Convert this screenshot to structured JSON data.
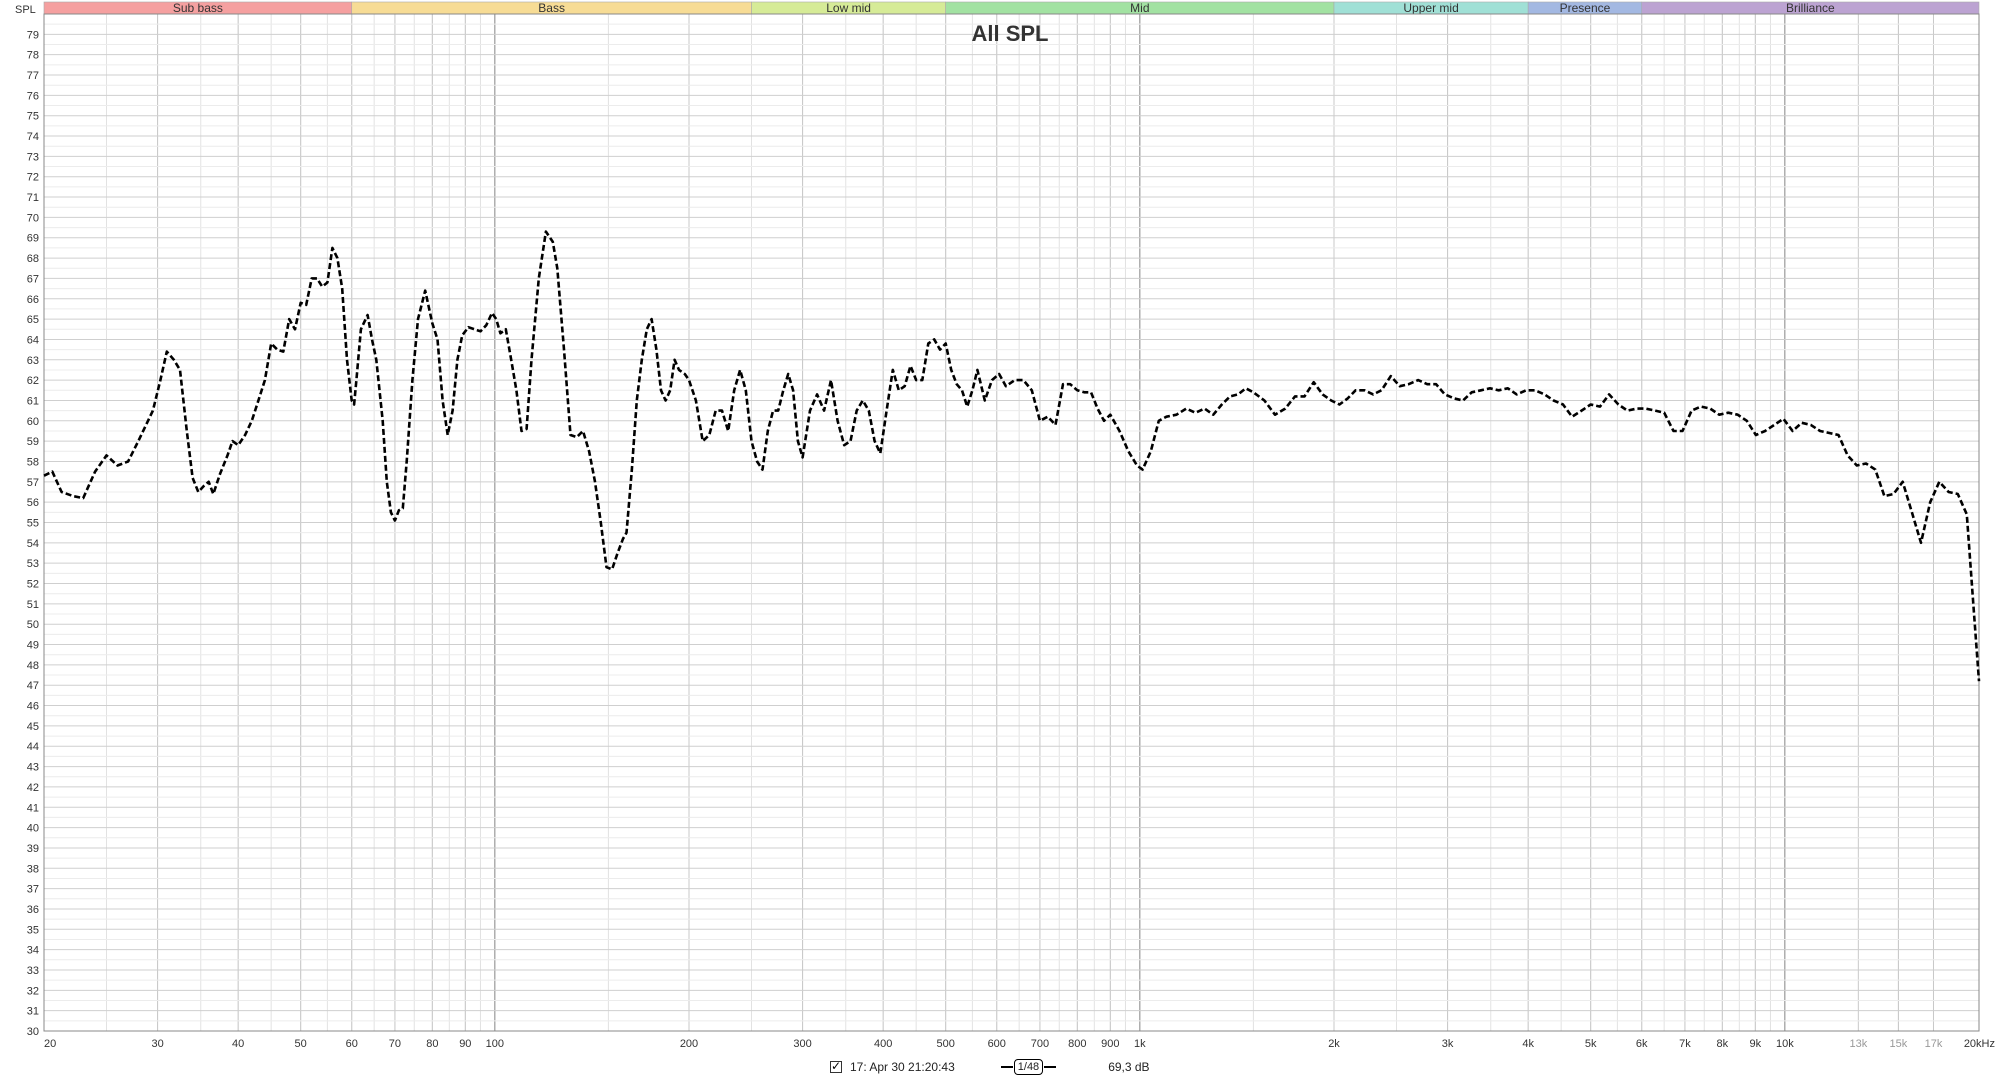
{
  "chart_data": {
    "type": "line",
    "title": "All SPL",
    "ylabel": "SPL",
    "xlabel": "",
    "xscale": "log",
    "xlim": [
      20,
      20000
    ],
    "ylim": [
      30,
      80
    ],
    "y_ticks": [
      30,
      31,
      32,
      33,
      34,
      35,
      36,
      37,
      38,
      39,
      40,
      41,
      42,
      43,
      44,
      45,
      46,
      47,
      48,
      49,
      50,
      51,
      52,
      53,
      54,
      55,
      56,
      57,
      58,
      59,
      60,
      61,
      62,
      63,
      64,
      65,
      66,
      67,
      68,
      69,
      70,
      71,
      72,
      73,
      74,
      75,
      76,
      77,
      78,
      79
    ],
    "x_ticks": [
      {
        "value": 20,
        "label": "20"
      },
      {
        "value": 30,
        "label": "30"
      },
      {
        "value": 40,
        "label": "40"
      },
      {
        "value": 50,
        "label": "50"
      },
      {
        "value": 60,
        "label": "60"
      },
      {
        "value": 70,
        "label": "70"
      },
      {
        "value": 80,
        "label": "80"
      },
      {
        "value": 90,
        "label": "90"
      },
      {
        "value": 100,
        "label": "100"
      },
      {
        "value": 200,
        "label": "200"
      },
      {
        "value": 300,
        "label": "300"
      },
      {
        "value": 400,
        "label": "400"
      },
      {
        "value": 500,
        "label": "500"
      },
      {
        "value": 600,
        "label": "600"
      },
      {
        "value": 700,
        "label": "700"
      },
      {
        "value": 800,
        "label": "800"
      },
      {
        "value": 900,
        "label": "900"
      },
      {
        "value": 1000,
        "label": "1k"
      },
      {
        "value": 2000,
        "label": "2k"
      },
      {
        "value": 3000,
        "label": "3k"
      },
      {
        "value": 4000,
        "label": "4k"
      },
      {
        "value": 5000,
        "label": "5k"
      },
      {
        "value": 6000,
        "label": "6k"
      },
      {
        "value": 7000,
        "label": "7k"
      },
      {
        "value": 8000,
        "label": "8k"
      },
      {
        "value": 9000,
        "label": "9k"
      },
      {
        "value": 10000,
        "label": "10k"
      },
      {
        "value": 13000,
        "label": "13k"
      },
      {
        "value": 15000,
        "label": "15k"
      },
      {
        "value": 17000,
        "label": "17k"
      },
      {
        "value": 20000,
        "label": "20kHz"
      }
    ],
    "grid": true,
    "bands": [
      {
        "name": "Sub bass",
        "from": 20,
        "to": 60,
        "color": "#f5a0a0"
      },
      {
        "name": "Bass",
        "from": 60,
        "to": 250,
        "color": "#f7dc95"
      },
      {
        "name": "Low mid",
        "from": 250,
        "to": 500,
        "color": "#d6eb97"
      },
      {
        "name": "Mid",
        "from": 500,
        "to": 2000,
        "color": "#a2e2a2"
      },
      {
        "name": "Upper mid",
        "from": 2000,
        "to": 4000,
        "color": "#a0e0d6"
      },
      {
        "name": "Presence",
        "from": 4000,
        "to": 6000,
        "color": "#a3b8e2"
      },
      {
        "name": "Brilliance",
        "from": 6000,
        "to": 20000,
        "color": "#bca3d2"
      }
    ],
    "series": [
      {
        "name": "17: Apr 30 21:20:43",
        "color": "#000000",
        "style": "dashed",
        "points": [
          [
            20,
            57.3
          ],
          [
            20.6,
            57.5
          ],
          [
            21.3,
            56.5
          ],
          [
            22.2,
            56.3
          ],
          [
            23,
            56.2
          ],
          [
            24,
            57.5
          ],
          [
            25,
            58.3
          ],
          [
            26,
            57.8
          ],
          [
            27,
            58
          ],
          [
            28,
            59
          ],
          [
            29.5,
            60.5
          ],
          [
            30.3,
            62
          ],
          [
            31,
            63.4
          ],
          [
            31.8,
            63
          ],
          [
            32.5,
            62.5
          ],
          [
            33.3,
            59.5
          ],
          [
            34,
            57.2
          ],
          [
            34.7,
            56.5
          ],
          [
            35.4,
            56.8
          ],
          [
            36,
            57
          ],
          [
            36.6,
            56.4
          ],
          [
            37.5,
            57.4
          ],
          [
            38.5,
            58.3
          ],
          [
            39.2,
            59
          ],
          [
            40,
            58.8
          ],
          [
            41,
            59.3
          ],
          [
            42,
            60
          ],
          [
            43,
            61
          ],
          [
            44,
            62
          ],
          [
            45,
            63.8
          ],
          [
            46,
            63.5
          ],
          [
            47,
            63.4
          ],
          [
            48,
            65
          ],
          [
            49,
            64.5
          ],
          [
            50,
            65.8
          ],
          [
            51,
            65.7
          ],
          [
            52,
            67
          ],
          [
            53,
            67
          ],
          [
            54,
            66.6
          ],
          [
            55,
            66.8
          ],
          [
            56,
            68.5
          ],
          [
            57,
            68
          ],
          [
            58,
            66.5
          ],
          [
            59,
            63
          ],
          [
            60,
            61
          ],
          [
            60.5,
            60.8
          ],
          [
            61,
            62
          ],
          [
            62,
            64.5
          ],
          [
            63.5,
            65.2
          ],
          [
            64.5,
            64
          ],
          [
            65.5,
            63
          ],
          [
            67,
            60
          ],
          [
            68,
            57
          ],
          [
            69,
            55.5
          ],
          [
            70,
            55.1
          ],
          [
            71,
            55.6
          ],
          [
            72,
            55.7
          ],
          [
            73,
            58
          ],
          [
            74.5,
            62
          ],
          [
            76,
            65
          ],
          [
            78,
            66.4
          ],
          [
            80,
            64.8
          ],
          [
            81.5,
            64
          ],
          [
            83,
            61
          ],
          [
            84.5,
            59.3
          ],
          [
            86,
            60.5
          ],
          [
            87.5,
            63
          ],
          [
            89,
            64.2
          ],
          [
            91,
            64.6
          ],
          [
            93,
            64.5
          ],
          [
            95,
            64.4
          ],
          [
            97,
            64.7
          ],
          [
            99,
            65.3
          ],
          [
            100.5,
            65
          ],
          [
            102,
            64.3
          ],
          [
            104,
            64.5
          ],
          [
            106,
            63
          ],
          [
            108,
            61.5
          ],
          [
            110,
            59.5
          ],
          [
            112,
            59.6
          ],
          [
            114,
            63
          ],
          [
            117,
            67
          ],
          [
            120,
            69.3
          ],
          [
            123,
            68.8
          ],
          [
            125,
            67.5
          ],
          [
            128,
            63.5
          ],
          [
            131,
            59.3
          ],
          [
            134,
            59.2
          ],
          [
            137,
            59.5
          ],
          [
            140,
            58.5
          ],
          [
            143,
            57
          ],
          [
            146,
            55
          ],
          [
            149,
            52.8
          ],
          [
            152,
            52.7
          ],
          [
            155,
            53.5
          ],
          [
            158,
            54.2
          ],
          [
            160,
            54.5
          ],
          [
            163,
            57.5
          ],
          [
            166,
            61
          ],
          [
            169,
            63
          ],
          [
            172,
            64.5
          ],
          [
            175,
            65
          ],
          [
            178,
            63.5
          ],
          [
            181,
            61.5
          ],
          [
            184,
            61
          ],
          [
            187,
            61.5
          ],
          [
            190,
            63
          ],
          [
            193,
            62.5
          ],
          [
            197,
            62.3
          ],
          [
            200,
            62
          ],
          [
            205,
            61
          ],
          [
            210,
            59
          ],
          [
            215,
            59.3
          ],
          [
            220,
            60.5
          ],
          [
            225,
            60.5
          ],
          [
            230,
            59.5
          ],
          [
            235,
            61.5
          ],
          [
            240,
            62.5
          ],
          [
            245,
            61.5
          ],
          [
            250,
            59
          ],
          [
            255,
            58
          ],
          [
            260,
            57.6
          ],
          [
            265,
            59.5
          ],
          [
            270,
            60.5
          ],
          [
            275,
            60.5
          ],
          [
            280,
            61.5
          ],
          [
            285,
            62.3
          ],
          [
            290,
            61.5
          ],
          [
            295,
            59
          ],
          [
            300,
            58.2
          ],
          [
            308,
            60.5
          ],
          [
            316,
            61.3
          ],
          [
            324,
            60.5
          ],
          [
            332,
            62
          ],
          [
            340,
            60
          ],
          [
            348,
            58.8
          ],
          [
            356,
            59
          ],
          [
            364,
            60.5
          ],
          [
            372,
            61
          ],
          [
            380,
            60.5
          ],
          [
            388,
            59
          ],
          [
            396,
            58.4
          ],
          [
            405,
            60.5
          ],
          [
            414,
            62.5
          ],
          [
            423,
            61.5
          ],
          [
            432,
            61.7
          ],
          [
            441,
            62.7
          ],
          [
            450,
            62
          ],
          [
            460,
            62
          ],
          [
            470,
            63.8
          ],
          [
            480,
            64
          ],
          [
            490,
            63.5
          ],
          [
            500,
            63.8
          ],
          [
            510,
            62.5
          ],
          [
            520,
            61.8
          ],
          [
            530,
            61.5
          ],
          [
            540,
            60.7
          ],
          [
            550,
            61.5
          ],
          [
            560,
            62.5
          ],
          [
            575,
            61
          ],
          [
            590,
            62
          ],
          [
            605,
            62.3
          ],
          [
            620,
            61.7
          ],
          [
            640,
            62
          ],
          [
            660,
            62
          ],
          [
            680,
            61.5
          ],
          [
            700,
            60
          ],
          [
            720,
            60.2
          ],
          [
            740,
            59.8
          ],
          [
            760,
            61.8
          ],
          [
            780,
            61.8
          ],
          [
            800,
            61.5
          ],
          [
            820,
            61.4
          ],
          [
            840,
            61.4
          ],
          [
            860,
            60.6
          ],
          [
            880,
            60
          ],
          [
            900,
            60.3
          ],
          [
            930,
            59.5
          ],
          [
            960,
            58.5
          ],
          [
            990,
            57.8
          ],
          [
            1010,
            57.6
          ],
          [
            1040,
            58.5
          ],
          [
            1070,
            60
          ],
          [
            1100,
            60.2
          ],
          [
            1140,
            60.3
          ],
          [
            1180,
            60.6
          ],
          [
            1220,
            60.4
          ],
          [
            1260,
            60.6
          ],
          [
            1300,
            60.3
          ],
          [
            1340,
            60.8
          ],
          [
            1380,
            61.2
          ],
          [
            1420,
            61.3
          ],
          [
            1460,
            61.6
          ],
          [
            1500,
            61.4
          ],
          [
            1560,
            61
          ],
          [
            1620,
            60.3
          ],
          [
            1680,
            60.6
          ],
          [
            1740,
            61.2
          ],
          [
            1800,
            61.2
          ],
          [
            1860,
            61.9
          ],
          [
            1920,
            61.3
          ],
          [
            1980,
            61
          ],
          [
            2040,
            60.8
          ],
          [
            2100,
            61.1
          ],
          [
            2160,
            61.5
          ],
          [
            2230,
            61.5
          ],
          [
            2300,
            61.3
          ],
          [
            2370,
            61.5
          ],
          [
            2450,
            62.2
          ],
          [
            2530,
            61.7
          ],
          [
            2610,
            61.8
          ],
          [
            2700,
            62
          ],
          [
            2790,
            61.8
          ],
          [
            2880,
            61.8
          ],
          [
            2970,
            61.3
          ],
          [
            3070,
            61.1
          ],
          [
            3170,
            61
          ],
          [
            3270,
            61.4
          ],
          [
            3380,
            61.5
          ],
          [
            3490,
            61.6
          ],
          [
            3600,
            61.5
          ],
          [
            3720,
            61.6
          ],
          [
            3840,
            61.3
          ],
          [
            3970,
            61.5
          ],
          [
            4100,
            61.5
          ],
          [
            4240,
            61.3
          ],
          [
            4380,
            61
          ],
          [
            4530,
            60.8
          ],
          [
            4680,
            60.2
          ],
          [
            4840,
            60.5
          ],
          [
            5000,
            60.8
          ],
          [
            5170,
            60.7
          ],
          [
            5340,
            61.3
          ],
          [
            5520,
            60.8
          ],
          [
            5700,
            60.5
          ],
          [
            5890,
            60.6
          ],
          [
            6090,
            60.6
          ],
          [
            6290,
            60.5
          ],
          [
            6500,
            60.4
          ],
          [
            6720,
            59.5
          ],
          [
            6940,
            59.5
          ],
          [
            7170,
            60.5
          ],
          [
            7410,
            60.7
          ],
          [
            7660,
            60.6
          ],
          [
            7910,
            60.3
          ],
          [
            8170,
            60.4
          ],
          [
            8450,
            60.3
          ],
          [
            8730,
            60
          ],
          [
            9020,
            59.3
          ],
          [
            9320,
            59.5
          ],
          [
            9630,
            59.8
          ],
          [
            9950,
            60.1
          ],
          [
            10280,
            59.5
          ],
          [
            10620,
            59.9
          ],
          [
            10970,
            59.8
          ],
          [
            11340,
            59.5
          ],
          [
            11720,
            59.4
          ],
          [
            12110,
            59.3
          ],
          [
            12510,
            58.3
          ],
          [
            12930,
            57.8
          ],
          [
            13360,
            57.9
          ],
          [
            13810,
            57.6
          ],
          [
            14270,
            56.3
          ],
          [
            14740,
            56.4
          ],
          [
            15230,
            57
          ],
          [
            15740,
            55.5
          ],
          [
            16260,
            54
          ],
          [
            16800,
            56
          ],
          [
            17360,
            57
          ],
          [
            17940,
            56.5
          ],
          [
            18540,
            56.4
          ],
          [
            19150,
            55.4
          ],
          [
            19600,
            51
          ],
          [
            20000,
            47.2
          ]
        ]
      }
    ],
    "legend": {
      "entry": "17: Apr 30 21:20:43",
      "smoothing": "1/48",
      "level": "69,3 dB"
    }
  }
}
